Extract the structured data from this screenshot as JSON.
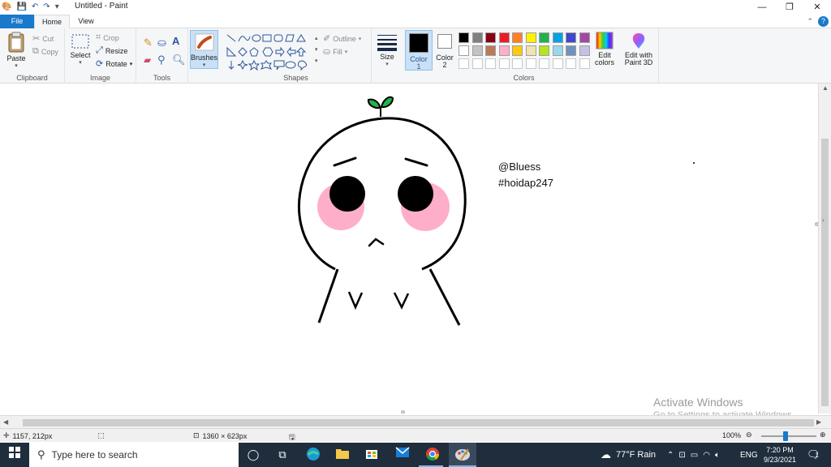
{
  "window": {
    "title": "Untitled - Paint",
    "controls": [
      "—",
      "❐",
      "✕"
    ]
  },
  "tabs": [
    "File",
    "Home",
    "View"
  ],
  "ribbon": {
    "clipboard": {
      "label": "Clipboard",
      "paste": "Paste",
      "cut": "Cut",
      "copy": "Copy"
    },
    "image": {
      "label": "Image",
      "select": "Select",
      "crop": "Crop",
      "resize": "Resize",
      "rotate": "Rotate"
    },
    "tools": {
      "label": "Tools"
    },
    "brushes": {
      "label": "Brushes"
    },
    "shapes": {
      "label": "Shapes",
      "outline": "Outline",
      "fill": "Fill"
    },
    "size": {
      "label": "Size"
    },
    "color1": {
      "label": "Color",
      "num": "1"
    },
    "color2": {
      "label": "Color",
      "num": "2"
    },
    "colors": {
      "label": "Colors",
      "edit_label_1": "Edit",
      "edit_label_2": "colors",
      "paint3d_label_1": "Edit with",
      "paint3d_label_2": "Paint 3D",
      "row1": [
        "#000000",
        "#7f7f7f",
        "#880015",
        "#ed1c24",
        "#ff7f27",
        "#fff200",
        "#22b14c",
        "#00a2e8",
        "#3f48cc",
        "#a349a4"
      ],
      "row2": [
        "#ffffff",
        "#c3c3c3",
        "#b97a57",
        "#ffaec9",
        "#ffc90e",
        "#efe4b0",
        "#b5e61d",
        "#99d9ea",
        "#7092be",
        "#c8bfe7"
      ]
    }
  },
  "canvas": {
    "text_line1": "@Bluess",
    "text_line2": "#hoidap247",
    "watermark_1": "Activate Windows",
    "watermark_2": "Go to Settings to activate Windows."
  },
  "status": {
    "cursor_pos": "1157, 212px",
    "image_size": "1360 × 623px",
    "zoom": "100%"
  },
  "taskbar": {
    "search_placeholder": "Type here to search",
    "weather": "77°F  Rain",
    "lang": "ENG",
    "time": "7:20 PM",
    "date": "9/23/2021",
    "notif_count": "1"
  }
}
